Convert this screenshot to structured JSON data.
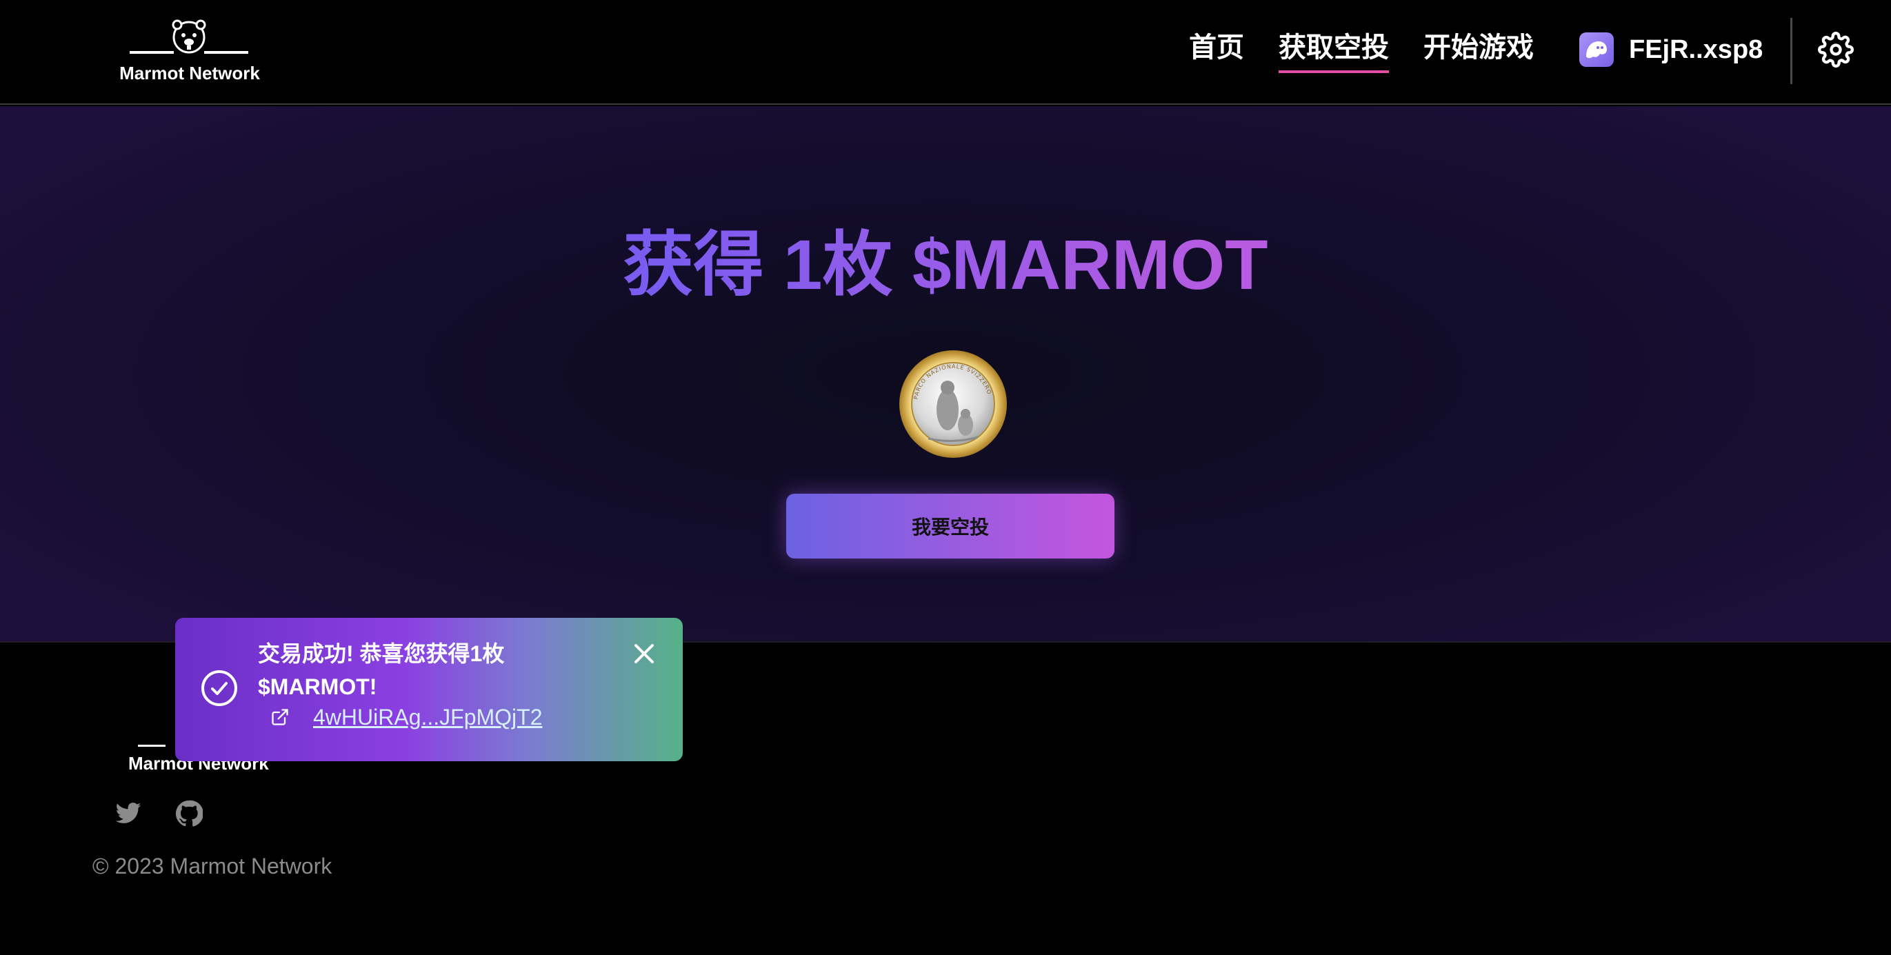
{
  "brand": {
    "name": "Marmot Network"
  },
  "nav": {
    "items": [
      {
        "label": "首页",
        "active": false
      },
      {
        "label": "获取空投",
        "active": true
      },
      {
        "label": "开始游戏",
        "active": false
      }
    ]
  },
  "wallet": {
    "address": "FEjR..xsp8",
    "icon": "phantom-ghost-icon"
  },
  "settings": {
    "icon": "gear-icon"
  },
  "hero": {
    "title": "获得 1枚 $MARMOT",
    "coin_icon": "marmot-coin",
    "coin_text": "PARCO NAZIONALE SVIZZERO",
    "claim_button": "我要空投"
  },
  "toast": {
    "message": "交易成功! 恭喜您获得1枚 $MARMOT!",
    "tx_link": "4wHUiRAg...JFpMQjT2",
    "status_icon": "check-circle-icon",
    "link_icon": "external-link-icon",
    "close_icon": "close-icon"
  },
  "footer": {
    "brand": "Marmot Network",
    "social": [
      {
        "icon": "twitter-icon"
      },
      {
        "icon": "github-icon"
      }
    ],
    "copyright": "© 2023 Marmot Network"
  },
  "colors": {
    "accent_pink": "#e14ea3",
    "title_gradient_start": "#7a5cf0",
    "title_gradient_end": "#b75be0",
    "toast_success": "#56b288"
  }
}
